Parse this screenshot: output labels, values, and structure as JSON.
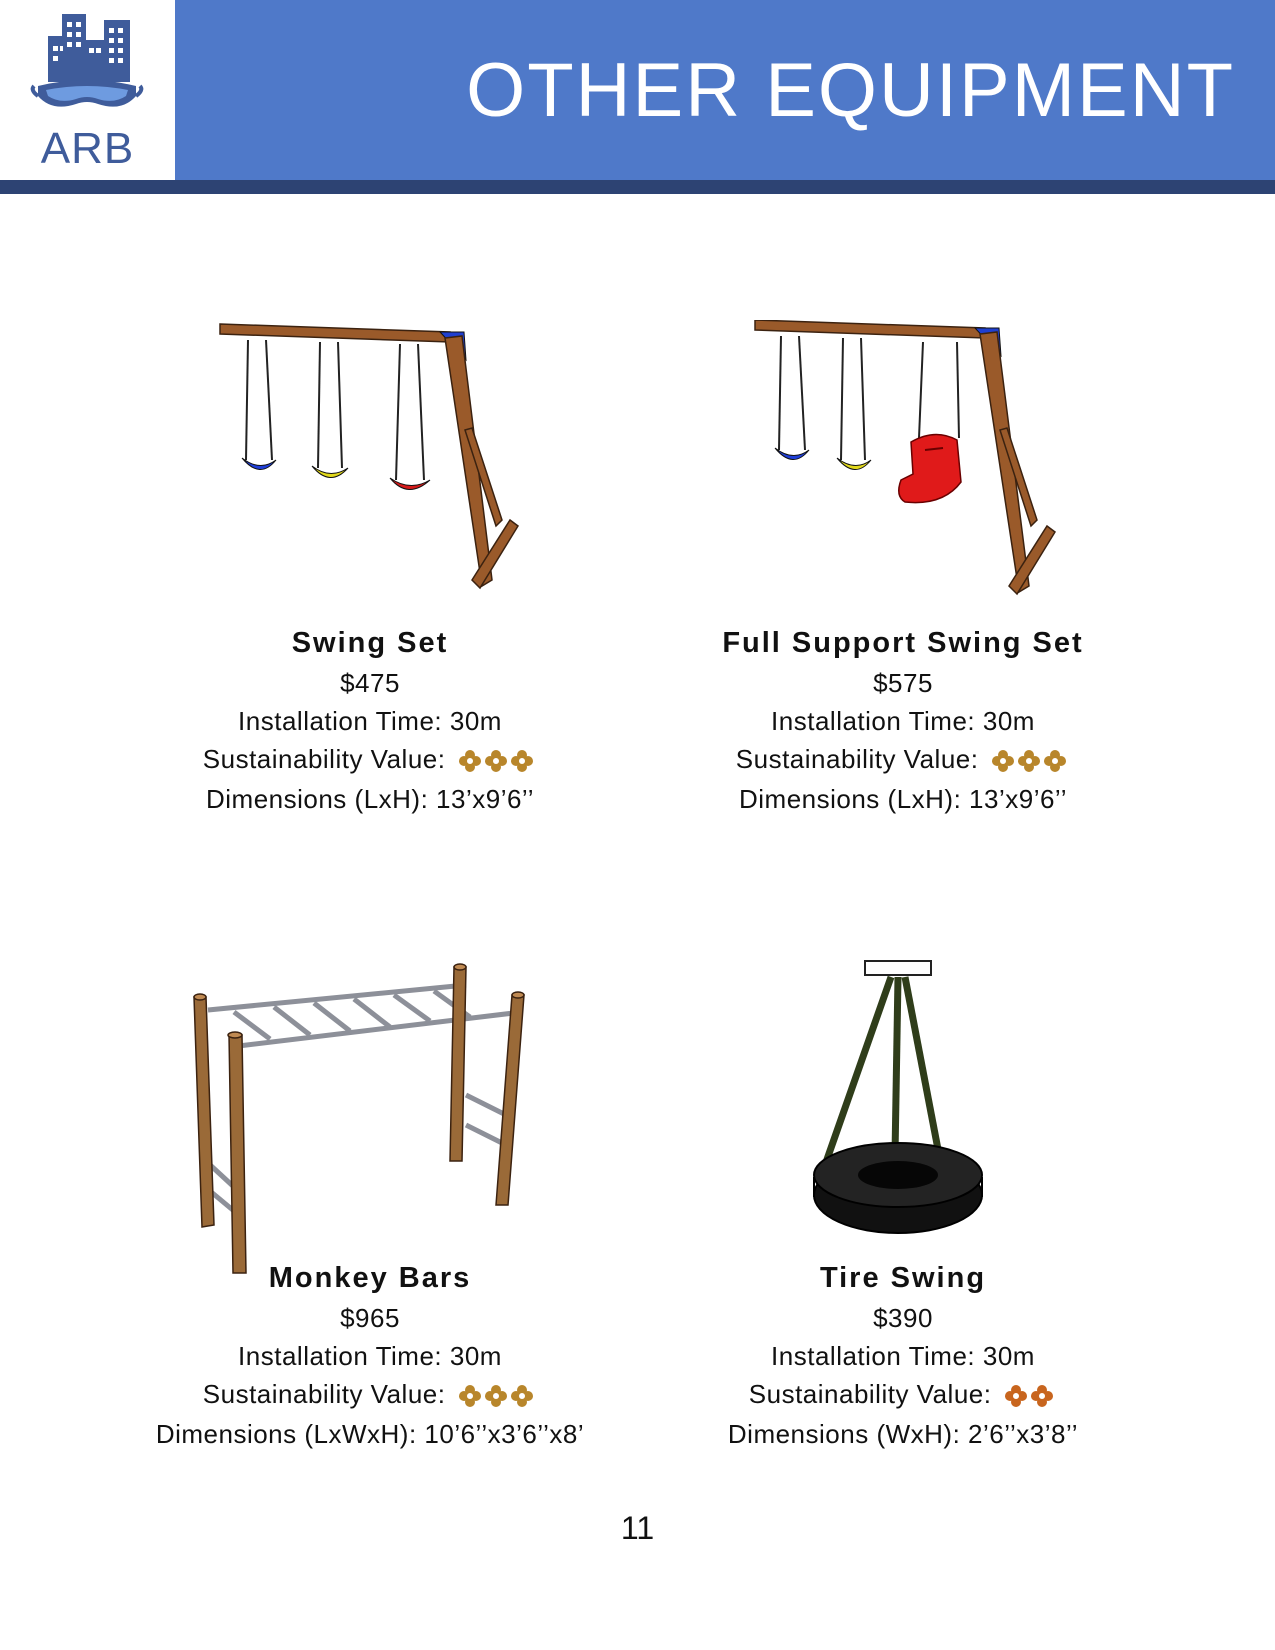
{
  "logo": {
    "text": "ARB"
  },
  "header": {
    "title": "OTHER EQUIPMENT"
  },
  "items": [
    {
      "name": "Swing Set",
      "price": "$475",
      "install": "Installation Time: 30m",
      "sustain_label": "Sustainability Value:",
      "sustain_rating": 3,
      "dimensions": "Dimensions (LxH): 13’x9’6’’",
      "icon": "swing-set-illustration"
    },
    {
      "name": "Full Support Swing Set",
      "price": "$575",
      "install": "Installation Time: 30m",
      "sustain_label": "Sustainability Value:",
      "sustain_rating": 3,
      "dimensions": "Dimensions (LxH): 13’x9’6’’",
      "icon": "full-support-swing-set-illustration"
    },
    {
      "name": "Monkey Bars",
      "price": "$965",
      "install": "Installation Time: 30m",
      "sustain_label": "Sustainability Value:",
      "sustain_rating": 3,
      "dimensions": "Dimensions (LxWxH): 10’6’’x3’6’’x8’",
      "icon": "monkey-bars-illustration"
    },
    {
      "name": "Tire Swing",
      "price": "$390",
      "install": "Installation Time: 30m",
      "sustain_label": "Sustainability Value:",
      "sustain_rating": 2,
      "dimensions": "Dimensions (WxH): 2’6’’x3’8’’",
      "icon": "tire-swing-illustration"
    }
  ],
  "page_number": "11",
  "colors": {
    "header": "#4f79c9",
    "header_bar": "#2d4373",
    "logo": "#3f5c9b",
    "wood": "#9a5a2a",
    "rating_gold": "#b8862b",
    "rating_orange": "#c8651e"
  }
}
